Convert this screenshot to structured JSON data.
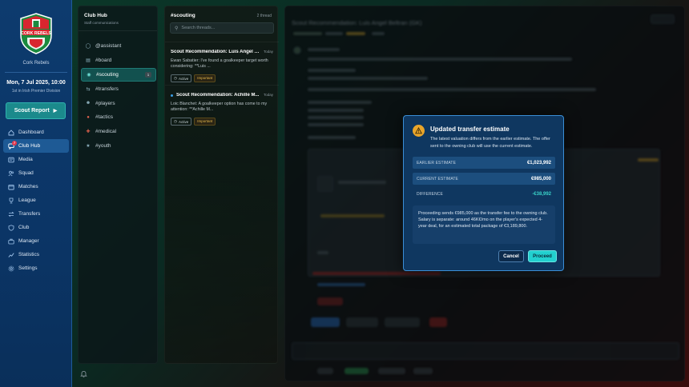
{
  "sidebar": {
    "club_name": "Cork Rebels",
    "crest_text": "CORK REBELS",
    "date": "Mon, 7 Jul 2025, 10:00",
    "rank": "1st in Irish Premier Division",
    "scout_button": "Scout Report",
    "nav": [
      {
        "label": "Dashboard",
        "icon": "home-icon"
      },
      {
        "label": "Club Hub",
        "icon": "chat-icon",
        "badge": "7"
      },
      {
        "label": "Media",
        "icon": "media-icon"
      },
      {
        "label": "Squad",
        "icon": "squad-icon"
      },
      {
        "label": "Matches",
        "icon": "calendar-icon"
      },
      {
        "label": "League",
        "icon": "trophy-icon"
      },
      {
        "label": "Transfers",
        "icon": "transfer-icon"
      },
      {
        "label": "Club",
        "icon": "shield-icon"
      },
      {
        "label": "Manager",
        "icon": "manager-icon"
      },
      {
        "label": "Statistics",
        "icon": "stats-icon"
      },
      {
        "label": "Settings",
        "icon": "gear-icon"
      }
    ]
  },
  "channels": {
    "title": "Club Hub",
    "subtitle": "Staff communications",
    "items": [
      {
        "label": "@assistant",
        "icon": "chat-icon"
      },
      {
        "label": "#board",
        "icon": "document-icon"
      },
      {
        "label": "#scouting",
        "icon": "binoculars-icon",
        "count": "1"
      },
      {
        "label": "#transfers",
        "icon": "transfer-icon"
      },
      {
        "label": "#players",
        "icon": "players-icon"
      },
      {
        "label": "#tactics",
        "icon": "tactics-icon"
      },
      {
        "label": "#medical",
        "icon": "medical-icon"
      },
      {
        "label": "#youth",
        "icon": "youth-icon"
      }
    ]
  },
  "threads": {
    "channel": "#scouting",
    "count": "2 thread",
    "search_placeholder": "Search threads...",
    "items": [
      {
        "title": "Scout Recommendation: Luis Angel B...",
        "date": "Today",
        "preview": "Ewan Sabatier: I've found a goalkeeper target worth considering: **Luis ...",
        "status": "Active",
        "priority": "Important"
      },
      {
        "title": "Scout Recommendation: Achille M...",
        "date": "Today",
        "preview": "Loic Blanchet: A goalkeeper option has come to my attention: **Achille M...",
        "status": "Active",
        "priority": "Important"
      }
    ]
  },
  "main": {
    "title": "Scout Recommendation: Luis Angel Beltran (GK)"
  },
  "modal": {
    "title": "Updated transfer estimate",
    "description": "The latest valuation differs from the earlier estimate. The offer sent to the owning club will use the current estimate.",
    "rows": [
      {
        "label": "EARLIER ESTIMATE",
        "value": "€1,023,992"
      },
      {
        "label": "CURRENT ESTIMATE",
        "value": "€985,000"
      },
      {
        "label": "DIFFERENCE",
        "value": "-€38,992"
      }
    ],
    "note": "Proceeding sends €985,000 as the transfer fee to the owning club. Salary is separate: around 46K€/mo on the player's expected 4-year deal, for an estimated total package of €3,189,800.",
    "cancel": "Cancel",
    "proceed": "Proceed"
  },
  "colors": {
    "accent": "#22d0cf",
    "sidebar": "#0d3b6e",
    "modal_border": "#3a8ed6",
    "warning": "#e9a52a",
    "badge": "#e2364b"
  }
}
